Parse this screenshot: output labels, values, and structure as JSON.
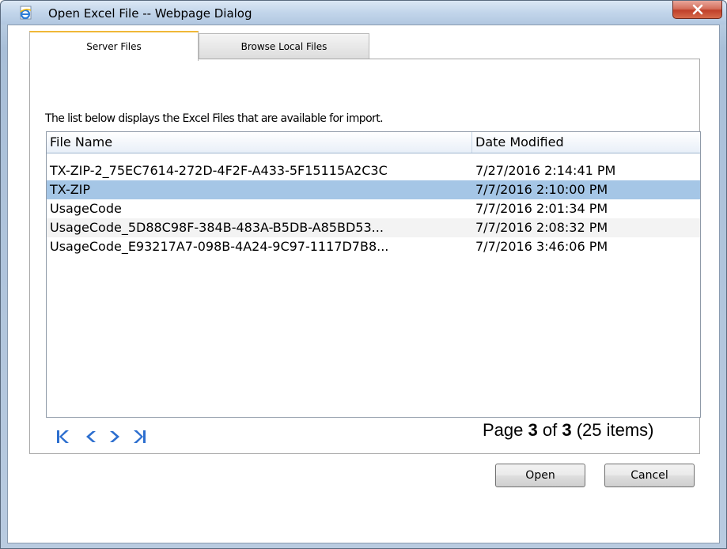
{
  "window": {
    "title": "Open Excel File -- Webpage Dialog"
  },
  "tabs": [
    {
      "label": "Server Files",
      "active": true
    },
    {
      "label": "Browse Local Files",
      "active": false
    }
  ],
  "description": "The list below displays the Excel Files that are available for import.",
  "grid": {
    "columns": [
      "File Name",
      "Date Modified"
    ],
    "rows": [
      {
        "file_name": "TX-ZIP-2_75EC7614-272D-4F2F-A433-5F15115A2C3C",
        "date_modified": "7/27/2016 2:14:41 PM",
        "selected": false
      },
      {
        "file_name": "TX-ZIP",
        "date_modified": "7/7/2016 2:10:00 PM",
        "selected": true
      },
      {
        "file_name": "UsageCode",
        "date_modified": "7/7/2016 2:01:34 PM",
        "selected": false
      },
      {
        "file_name": "UsageCode_5D88C98F-384B-483A-B5DB-A85BD53...",
        "date_modified": "7/7/2016 2:08:32 PM",
        "selected": false
      },
      {
        "file_name": "UsageCode_E93217A7-098B-4A24-9C97-1117D7B8...",
        "date_modified": "7/7/2016 3:46:06 PM",
        "selected": false
      }
    ]
  },
  "pager": {
    "icons": [
      "first-page-icon",
      "previous-page-icon",
      "next-page-icon",
      "last-page-icon"
    ],
    "page_prefix": "Page ",
    "current_page": "3",
    "of_text": " of ",
    "total_pages": "3",
    "items_text": " (25 items)"
  },
  "buttons": {
    "open": "Open",
    "cancel": "Cancel"
  },
  "colors": {
    "selected_row": "#a5c6e6",
    "pager_icons": "#2d6fcf",
    "active_tab_accent": "#f0b838"
  }
}
